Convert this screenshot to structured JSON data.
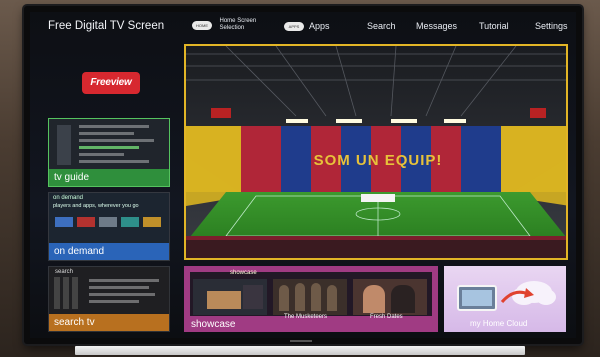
{
  "screen_title": "Free Digital TV Screen",
  "nav": {
    "home_selection_line1": "Home Screen",
    "home_selection_line2": "Selection",
    "apps": "Apps",
    "search": "Search",
    "messages": "Messages",
    "tutorial": "Tutorial",
    "settings": "Settings"
  },
  "freeview_logo": "Freeview",
  "tiles": {
    "tv_guide": {
      "label": "tv guide",
      "color": "#2f8f3c"
    },
    "on_demand": {
      "label": "on demand",
      "color": "#2a64b8",
      "header": "on demand",
      "subheader": "players and apps, wherever you go"
    },
    "search_tv": {
      "label": "search tv",
      "color": "#b8701f",
      "header": "search"
    },
    "showcase": {
      "label": "showcase",
      "color": "#a03b83",
      "header": "showcase",
      "items": [
        {
          "caption": ""
        },
        {
          "caption": "The Musketeers"
        },
        {
          "caption": "Fresh Dates"
        }
      ]
    },
    "home_cloud": {
      "label": "my Home Cloud",
      "color": "#d6b9e8"
    }
  },
  "stadium": {
    "banner": "SOM UN EQUIP!",
    "accent_border": "#e2b526"
  }
}
